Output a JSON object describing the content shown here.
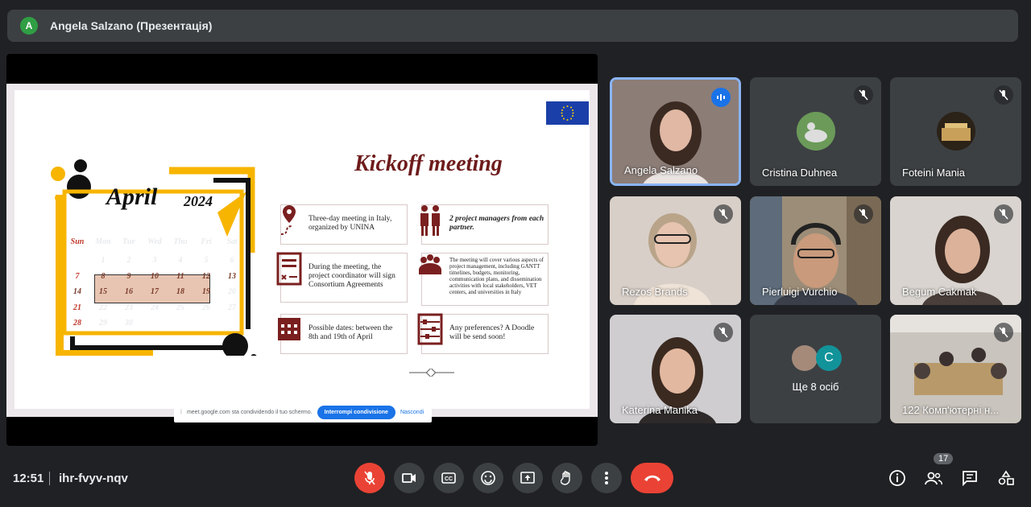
{
  "header": {
    "avatar_letter": "A",
    "title": "Angela Salzano (Презентація)"
  },
  "slide": {
    "title": "Kickoff meeting",
    "calendar": {
      "month": "April",
      "year": "2024",
      "weekdays": [
        "Sun",
        "Mon",
        "Tue",
        "Wed",
        "Thu",
        "Fri",
        "Sat"
      ],
      "days": [
        "",
        "1",
        "2",
        "3",
        "4",
        "5",
        "6",
        "7",
        "8",
        "9",
        "10",
        "11",
        "12",
        "13",
        "14",
        "15",
        "16",
        "17",
        "18",
        "19",
        "20",
        "21",
        "22",
        "23",
        "24",
        "25",
        "26",
        "27",
        "28",
        "29",
        "30",
        "",
        "",
        "",
        ""
      ]
    },
    "cards": [
      {
        "text": "Three-day meeting in Italy, organized by UNINA"
      },
      {
        "text": "2 project managers from each partner."
      },
      {
        "text": "During the meeting, the project coordinator will sign Consortium Agreements"
      },
      {
        "text": "The meeting will cover various aspects of project management, including GANTT timelines, budgets, monitoring, communication plans, and dissemination activities with local stakeholders, VET centers, and universities in Italy"
      },
      {
        "text": "Possible dates: between the 8th and 19th of April"
      },
      {
        "text": "Any preferences? A Doodle will be send soon!"
      }
    ]
  },
  "sharebar": {
    "text": "meet.google.com sta condividendo il tuo schermo.",
    "stop_label": "Interrompi condivisione",
    "hide_label": "Nascondi"
  },
  "participants": [
    {
      "name": "Angela Salzano"
    },
    {
      "name": "Cristina Duhnea"
    },
    {
      "name": "Foteini Mania"
    },
    {
      "name": "Rezos Brands"
    },
    {
      "name": "Pierluigi Vurchio"
    },
    {
      "name": "Begum Cakmak"
    },
    {
      "name": "Katerina Manika"
    },
    {
      "name": "Ще 8 осіб",
      "avatar_letter": "C"
    },
    {
      "name": "122 Комп'ютерні н..."
    }
  ],
  "footer": {
    "time": "12:51",
    "meeting_code": "ihr-fvyv-nqv",
    "participant_count": "17"
  },
  "colors": {
    "end_call": "#ea4335",
    "mic_off": "#ea4335",
    "accent": "#8ab4f8"
  }
}
